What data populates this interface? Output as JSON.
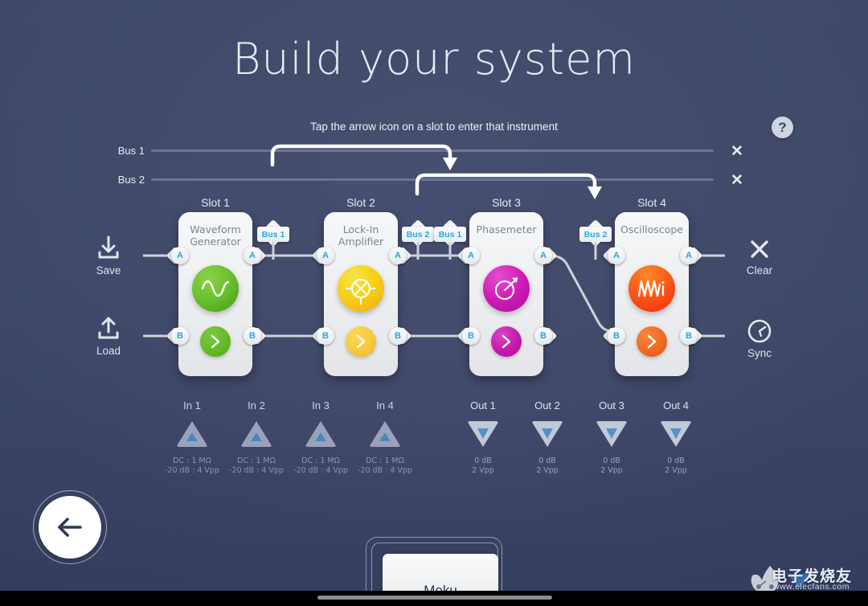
{
  "page": {
    "title": "Build your system",
    "hint": "Tap the arrow icon on a slot to enter that instrument",
    "help_label": "?",
    "background_color": "#414a6a",
    "accent_blue": "#26a9e0"
  },
  "buses": [
    {
      "label": "Bus 1",
      "close_label": "✕"
    },
    {
      "label": "Bus 2",
      "close_label": "✕"
    }
  ],
  "slots": [
    {
      "title": "Slot 1",
      "instrument": "Waveform Generator",
      "icon": "sine-wave-icon",
      "color": "#5bb72a",
      "ports": {
        "in_a": "A",
        "in_b": "B",
        "out_a": "A",
        "out_b": "B"
      },
      "enter_label": "›"
    },
    {
      "title": "Slot 2",
      "instrument": "Lock-In Amplifier",
      "icon": "mixer-icon",
      "color": "#f5c518",
      "ports": {
        "in_a": "A",
        "in_b": "B",
        "out_a": "A",
        "out_b": "B"
      },
      "enter_label": "›"
    },
    {
      "title": "Slot 3",
      "instrument": "Phasemeter",
      "icon": "phase-dial-icon",
      "color": "#cc19b0",
      "ports": {
        "in_a": "A",
        "in_b": "B",
        "out_a": "A",
        "out_b": "B"
      },
      "enter_label": "›"
    },
    {
      "title": "Slot 4",
      "instrument": "Oscilloscope",
      "icon": "waveform-icon",
      "color": "#f2411b",
      "ports": {
        "in_a": "A",
        "in_b": "B",
        "out_a": "A",
        "out_b": "B"
      },
      "enter_label": "›"
    }
  ],
  "bus_tags": [
    {
      "label": "Bus 1"
    },
    {
      "label": "Bus 2"
    },
    {
      "label": "Bus 1"
    },
    {
      "label": "Bus 2"
    }
  ],
  "left_actions": [
    {
      "label": "Save",
      "icon": "save-download-icon"
    },
    {
      "label": "Load",
      "icon": "load-upload-icon"
    }
  ],
  "right_actions": [
    {
      "label": "Clear",
      "icon": "close-x-icon"
    },
    {
      "label": "Sync",
      "icon": "sync-clock-icon"
    }
  ],
  "inputs": [
    {
      "name": "In 1",
      "line1": "DC : 1 MΩ",
      "line2": "-20 dB : 4 Vpp"
    },
    {
      "name": "In 2",
      "line1": "DC : 1 MΩ",
      "line2": "-20 dB : 4 Vpp"
    },
    {
      "name": "In 3",
      "line1": "DC : 1 MΩ",
      "line2": "-20 dB : 4 Vpp"
    },
    {
      "name": "In 4",
      "line1": "DC : 1 MΩ",
      "line2": "-20 dB : 4 Vpp"
    }
  ],
  "outputs": [
    {
      "name": "Out 1",
      "line1": "0 dB",
      "line2": "2 Vpp"
    },
    {
      "name": "Out 2",
      "line1": "0 dB",
      "line2": "2 Vpp"
    },
    {
      "name": "Out 3",
      "line1": "0 dB",
      "line2": "2 Vpp"
    },
    {
      "name": "Out 4",
      "line1": "0 dB",
      "line2": "2 Vpp"
    }
  ],
  "back_button": {
    "icon": "arrow-left-icon"
  },
  "dock": {
    "device_name": "Moku"
  },
  "watermark": {
    "text": "电子发烧友",
    "url": "www.elecfans.com"
  }
}
